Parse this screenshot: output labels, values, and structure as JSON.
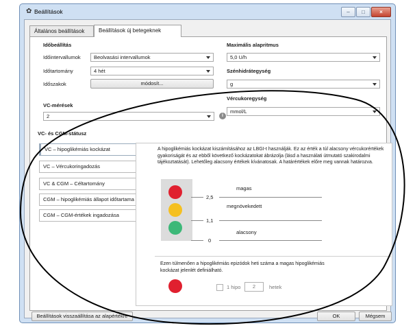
{
  "window": {
    "title": "Beállítások",
    "gear_icon": "gear-icon",
    "min": "–",
    "max": "□",
    "close": "×"
  },
  "tabs": [
    {
      "label": "Általános beállítások"
    },
    {
      "label": "Beállítások új betegeknek"
    }
  ],
  "time": {
    "heading": "Időbeállítás",
    "intervals_label": "Időintervallumok",
    "intervals_value": "Beolvasási intervallumok",
    "range_label": "Időtartomány",
    "range_value": "4 hét",
    "periods_label": "Időszakok",
    "periods_button": "módosít..."
  },
  "basal": {
    "heading": "Maximális alapritmus",
    "value": "5,0 U/h"
  },
  "carb": {
    "heading": "Szénhidrátegység",
    "value": "g"
  },
  "bg": {
    "heading": "Vércukoregység",
    "value": "mmol/L"
  },
  "vc": {
    "heading": "VC-mérések",
    "value": "2",
    "info": "i"
  },
  "status": {
    "heading": "VC- és CGM-státusz",
    "items": [
      {
        "label": "VC – hipoglikémiás kockázat"
      },
      {
        "label": "VC – Vércukoringadozás"
      },
      {
        "label": "VC & CGM – Céltartomány"
      },
      {
        "label": "CGM – hipoglikémiás állapot időtartama"
      },
      {
        "label": "CGM – CGM-értékek ingadozása"
      }
    ]
  },
  "detail": {
    "description": "A hipoglikémiás kockázat kiszámításához az LBGI-t használják. Ez az érték a túl alacsony vércukorértékek gyakoriságát és az ebből következő kockázatokat ábrázolja (lásd a használati útmutató szakirodalmi tájékoztatását). Lehetőleg alacsony értékek kívánatosak. A határértékek előre meg vannak határozva.",
    "levels": [
      {
        "label": "magas",
        "color": "#e0202f"
      },
      {
        "label": "megnövekedett",
        "color": "#f5c020"
      },
      {
        "label": "alacsony",
        "color": "#3cb878"
      }
    ],
    "thresholds": [
      "2,5",
      "1,1",
      "0"
    ],
    "note": "Ezen túlmenően a hipoglikémiás epizódok heti száma a magas hipoglikémiás kockázat jelenlét definiálható.",
    "hypo_prefix": "1 hipo",
    "hypo_count": "2",
    "hypo_suffix": "hetek",
    "hypo_color": "#e0202f"
  },
  "footer": {
    "reset": "Beállítások visszaállítása az alapértékre",
    "ok": "OK",
    "cancel": "Mégsem"
  }
}
